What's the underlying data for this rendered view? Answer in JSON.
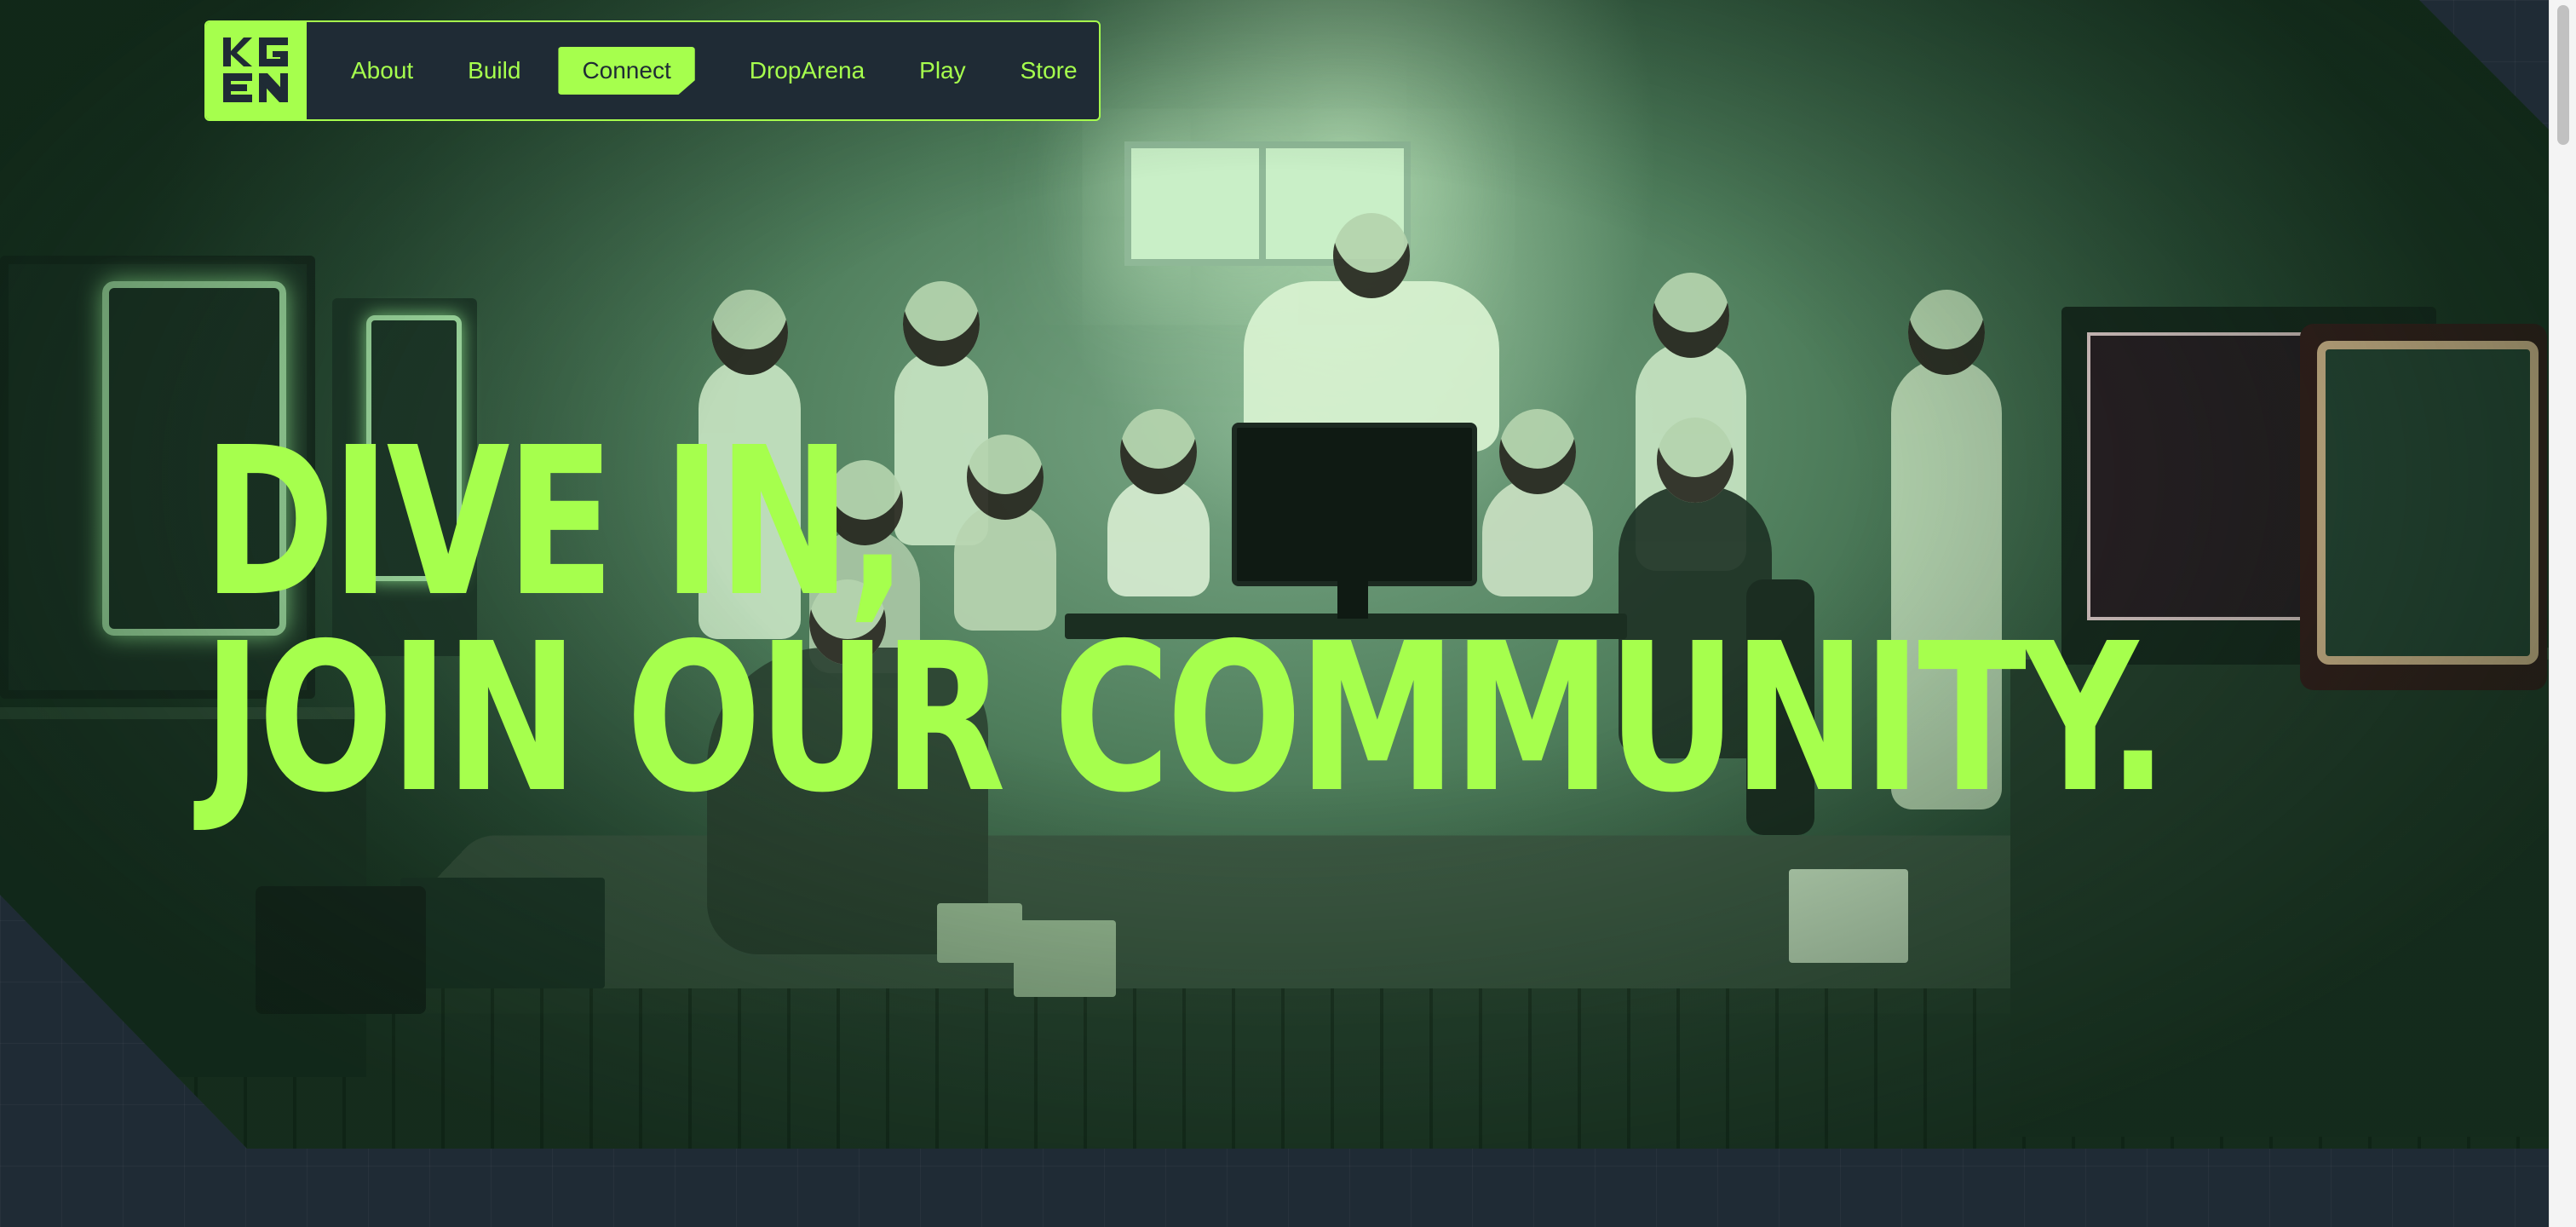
{
  "brand": {
    "logo_text": "KGEN"
  },
  "nav": {
    "items": [
      {
        "label": "About"
      },
      {
        "label": "Build"
      },
      {
        "label": "Connect"
      },
      {
        "label": "DropArena"
      },
      {
        "label": "Play"
      },
      {
        "label": "Store"
      }
    ]
  },
  "hero": {
    "title_line1": "DIVE IN,",
    "title_line2": "JOIN OUR COMMUNITY."
  },
  "colors": {
    "accent": "#a6ff4d",
    "background": "#1f2b35"
  }
}
